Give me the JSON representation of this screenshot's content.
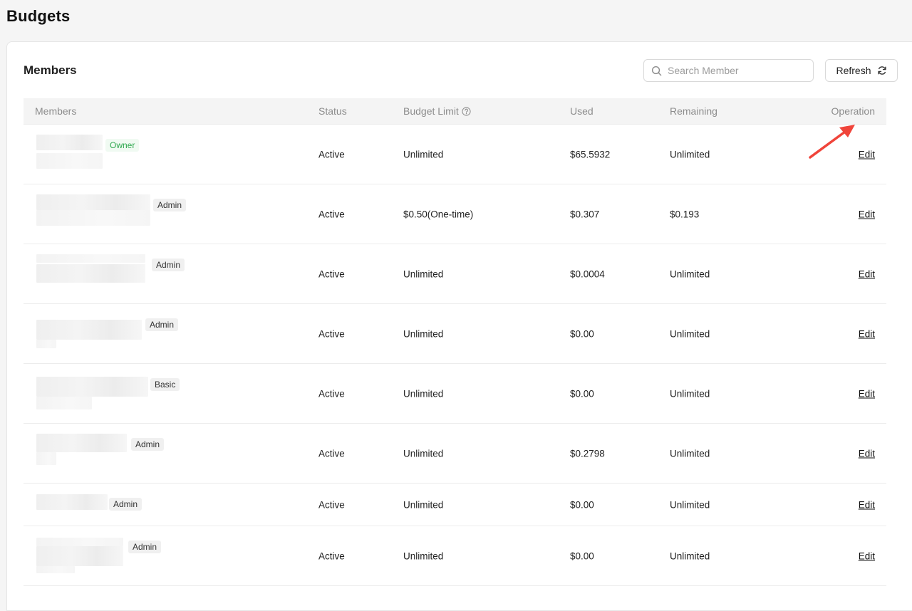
{
  "page": {
    "title": "Budgets"
  },
  "card": {
    "title": "Members"
  },
  "search": {
    "placeholder": "Search Member",
    "value": ""
  },
  "toolbar": {
    "refresh_label": "Refresh"
  },
  "table": {
    "columns": {
      "members": "Members",
      "status": "Status",
      "budget_limit": "Budget Limit",
      "used": "Used",
      "remaining": "Remaining",
      "operation": "Operation"
    },
    "rows": [
      {
        "role": "Owner",
        "status": "Active",
        "budget_limit": "Unlimited",
        "used": "$65.5932",
        "remaining": "Unlimited",
        "action": "Edit"
      },
      {
        "role": "Admin",
        "status": "Active",
        "budget_limit": "$0.50(One-time)",
        "used": "$0.307",
        "remaining": "$0.193",
        "action": "Edit"
      },
      {
        "role": "Admin",
        "status": "Active",
        "budget_limit": "Unlimited",
        "used": "$0.0004",
        "remaining": "Unlimited",
        "action": "Edit"
      },
      {
        "role": "Admin",
        "status": "Active",
        "budget_limit": "Unlimited",
        "used": "$0.00",
        "remaining": "Unlimited",
        "action": "Edit"
      },
      {
        "role": "Basic",
        "status": "Active",
        "budget_limit": "Unlimited",
        "used": "$0.00",
        "remaining": "Unlimited",
        "action": "Edit"
      },
      {
        "role": "Admin",
        "status": "Active",
        "budget_limit": "Unlimited",
        "used": "$0.2798",
        "remaining": "Unlimited",
        "action": "Edit"
      },
      {
        "role": "Admin",
        "status": "Active",
        "budget_limit": "Unlimited",
        "used": "$0.00",
        "remaining": "Unlimited",
        "action": "Edit"
      },
      {
        "role": "Admin",
        "status": "Active",
        "budget_limit": "Unlimited",
        "used": "$0.00",
        "remaining": "Unlimited",
        "action": "Edit"
      }
    ]
  },
  "icons": {
    "search": "search-icon",
    "refresh": "refresh-icon",
    "help": "help-circle-icon"
  },
  "colors": {
    "owner_tag": "#2fa84f",
    "annotation_arrow": "#f0443a"
  }
}
